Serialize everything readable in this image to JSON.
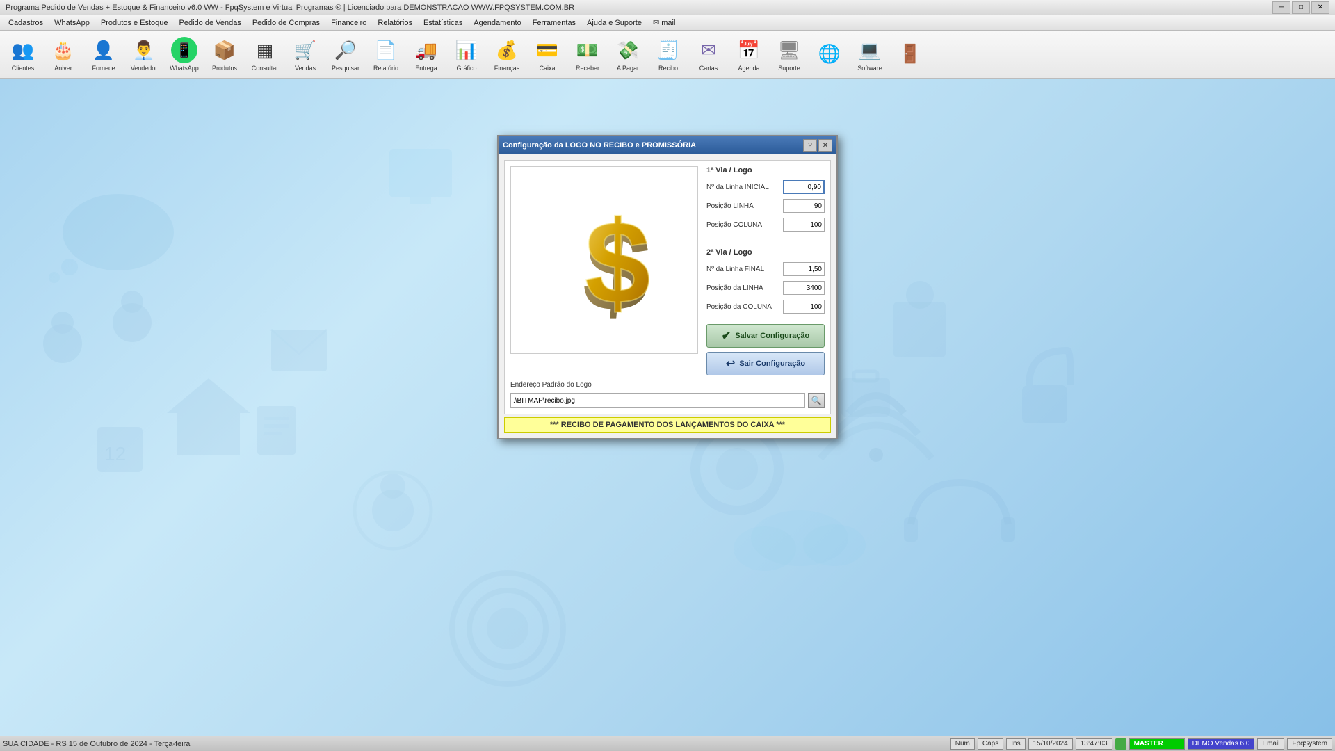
{
  "titlebar": {
    "text": "Programa Pedido de Vendas + Estoque & Financeiro v6.0 WW - FpqSystem e Virtual Programas ® | Licenciado para  DEMONSTRACAO WWW.FPQSYSTEM.COM.BR",
    "minimize": "─",
    "maximize": "□",
    "close": "✕"
  },
  "menubar": {
    "items": [
      {
        "label": "Cadastros",
        "id": "menu-cadastros"
      },
      {
        "label": "WhatsApp",
        "id": "menu-whatsapp"
      },
      {
        "label": "Produtos e Estoque",
        "id": "menu-produtos"
      },
      {
        "label": "Pedido de Vendas",
        "id": "menu-vendas"
      },
      {
        "label": "Pedido de Compras",
        "id": "menu-compras"
      },
      {
        "label": "Financeiro",
        "id": "menu-financeiro"
      },
      {
        "label": "Relatórios",
        "id": "menu-relatorios"
      },
      {
        "label": "Estatísticas",
        "id": "menu-estatisticas"
      },
      {
        "label": "Agendamento",
        "id": "menu-agendamento"
      },
      {
        "label": "Ferramentas",
        "id": "menu-ferramentas"
      },
      {
        "label": "Ajuda e Suporte",
        "id": "menu-ajuda"
      },
      {
        "label": "✉ mail",
        "id": "menu-mail"
      }
    ]
  },
  "toolbar": {
    "buttons": [
      {
        "id": "btn-clientes",
        "label": "Clientes",
        "icon": "👥"
      },
      {
        "id": "btn-aniver",
        "label": "Aniver",
        "icon": "🎂"
      },
      {
        "id": "btn-fornece",
        "label": "Fornece",
        "icon": "👤"
      },
      {
        "id": "btn-vendedor",
        "label": "Vendedor",
        "icon": "👨‍💼"
      },
      {
        "id": "btn-whatsapp",
        "label": "WhatsApp",
        "icon": "whatsapp"
      },
      {
        "id": "btn-produtos",
        "label": "Produtos",
        "icon": "📦"
      },
      {
        "id": "btn-consultar",
        "label": "Consultar",
        "icon": "🔍"
      },
      {
        "id": "btn-vendas",
        "label": "Vendas",
        "icon": "🛒"
      },
      {
        "id": "btn-pesquisar",
        "label": "Pesquisar",
        "icon": "🔎"
      },
      {
        "id": "btn-relatorio",
        "label": "Relatório",
        "icon": "📄"
      },
      {
        "id": "btn-entrega",
        "label": "Entrega",
        "icon": "🚚"
      },
      {
        "id": "btn-grafico",
        "label": "Gráfico",
        "icon": "📊"
      },
      {
        "id": "btn-financas",
        "label": "Finanças",
        "icon": "💰"
      },
      {
        "id": "btn-caixa",
        "label": "Caixa",
        "icon": "💳"
      },
      {
        "id": "btn-receber",
        "label": "Receber",
        "icon": "💵"
      },
      {
        "id": "btn-apagar",
        "label": "A Pagar",
        "icon": "💸"
      },
      {
        "id": "btn-recibo",
        "label": "Recibo",
        "icon": "🧾"
      },
      {
        "id": "btn-cartas",
        "label": "Cartas",
        "icon": "✉"
      },
      {
        "id": "btn-agenda",
        "label": "Agenda",
        "icon": "📅"
      },
      {
        "id": "btn-suporte",
        "label": "Suporte",
        "icon": "🖥"
      },
      {
        "id": "btn-globe",
        "label": "",
        "icon": "🌐"
      },
      {
        "id": "btn-software",
        "label": "Software",
        "icon": "💻"
      },
      {
        "id": "btn-exit",
        "label": "",
        "icon": "🚪"
      }
    ]
  },
  "modal": {
    "title": "Configuração da LOGO NO RECIBO e PROMISSÓRIA",
    "help_btn": "?",
    "close_btn": "✕",
    "section1": {
      "title": "1ª Via / Logo",
      "fields": [
        {
          "label": "Nº da Linha INICIAL",
          "value": "0,90",
          "id": "linha-inicial"
        },
        {
          "label": "Posição LINHA",
          "value": "90",
          "id": "posicao-linha"
        },
        {
          "label": "Posição COLUNA",
          "value": "100",
          "id": "posicao-coluna"
        }
      ]
    },
    "section2": {
      "title": "2ª Via / Logo",
      "fields": [
        {
          "label": "Nº da Linha FINAL",
          "value": "1,50",
          "id": "linha-final"
        },
        {
          "label": "Posição da LINHA",
          "value": "3400",
          "id": "posicao-linha2"
        },
        {
          "label": "Posição da COLUNA",
          "value": "100",
          "id": "posicao-coluna2"
        }
      ]
    },
    "address": {
      "label": "Endereço Padrão do Logo",
      "value": ".\\BITMAP\\recibo.jpg"
    },
    "buttons": {
      "save": "Salvar Configuração",
      "exit": "Sair Configuração"
    },
    "footer": "*** RECIBO DE PAGAMENTO DOS LANÇAMENTOS DO CAIXA ***"
  },
  "statusbar": {
    "city": "SUA CIDADE - RS 15 de Outubro de 2024 - Terça-feira",
    "num": "Num",
    "caps": "Caps",
    "ins": "Ins",
    "date": "15/10/2024",
    "time": "13:47:03",
    "master": "MASTER",
    "demo": "DEMO Vendas 6.0",
    "email": "Email",
    "fpqsystem": "FpqSystem"
  }
}
